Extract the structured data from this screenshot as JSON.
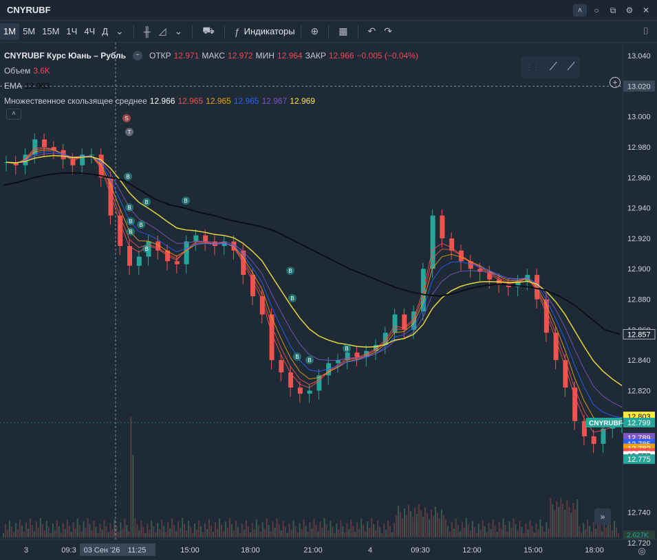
{
  "window": {
    "title": "CNYRUBF"
  },
  "toolbar": {
    "timeframes": [
      "1М",
      "5М",
      "15М",
      "1Ч",
      "4Ч",
      "Д"
    ],
    "active_timeframe": "1М",
    "indicators_label": "Индикаторы"
  },
  "legend": {
    "symbol": "CNYRUBF Курс Юань – Рубль",
    "open_label": "ОТКР",
    "open_value": "12.971",
    "high_label": "МАКС",
    "high_value": "12.972",
    "low_label": "МИН",
    "low_value": "12.964",
    "close_label": "ЗАКР",
    "close_value": "12.966",
    "change": "−0.005 (−0.04%)",
    "volume_label": "Объем",
    "volume_value": "3.6K",
    "ema_label": "EMA",
    "ema_value": "12.963",
    "mma_label": "Множественное скользящее среднее",
    "mma_values": [
      "12.966",
      "12.965",
      "12.965",
      "12.965",
      "12.967",
      "12.969"
    ]
  },
  "colors": {
    "background": "#1e2a36",
    "up": "#26a69a",
    "down": "#ef5350",
    "ema": "#000000",
    "mma": [
      "#ef5350",
      "#ef5350",
      "#f39c12",
      "#2962ff",
      "#7e57c2",
      "#ffeb3b"
    ]
  },
  "chart_data": {
    "type": "line",
    "subtype": "candlestick",
    "y_ticks": [
      "13.040",
      "13.020",
      "13.000",
      "12.980",
      "12.960",
      "12.940",
      "12.920",
      "12.900",
      "12.880",
      "12.860",
      "12.840",
      "12.820",
      "12.803",
      "12.799",
      "12.789",
      "12.785",
      "12.782",
      "12.779",
      "12.777",
      "12.775",
      "12.740",
      "12.720"
    ],
    "ylim": [
      12.72,
      13.045
    ],
    "x_ticks": [
      "3",
      "09:3",
      "03 Сен '26",
      "11:25",
      "15:00",
      "18:00",
      "21:00",
      "4",
      "09:30",
      "12:00",
      "15:00",
      "18:00"
    ],
    "crosshair": {
      "price": "13.020",
      "time": "03 Сен '26  11:25"
    },
    "price_labels": [
      {
        "text": "12.857",
        "color": "#1e2a36",
        "border": "#aab0ba"
      },
      {
        "text": "12.803",
        "color": "#ffeb3b"
      },
      {
        "text": "12.799",
        "color": "#26a69a",
        "tag": "CNYRUBF"
      },
      {
        "text": "12.789",
        "color": "#7e57c2"
      },
      {
        "text": "12.785",
        "color": "#2962ff"
      },
      {
        "text": "12.782",
        "color": "#f39c12"
      },
      {
        "text": "12.779",
        "color": "#ef5350"
      },
      {
        "text": "12.777",
        "color": "#ffffff"
      },
      {
        "text": "12.775",
        "color": "#26a69a"
      }
    ],
    "volume_label": "2.627K",
    "close_series": [
      12.97,
      12.968,
      12.975,
      12.985,
      12.98,
      12.978,
      12.972,
      12.968,
      12.975,
      12.975,
      12.96,
      12.935,
      12.915,
      12.902,
      12.908,
      12.918,
      12.912,
      12.905,
      12.903,
      12.918,
      12.922,
      12.918,
      12.915,
      12.918,
      12.912,
      12.896,
      12.882,
      12.87,
      12.84,
      12.832,
      12.822,
      12.818,
      12.82,
      12.83,
      12.838,
      12.84,
      12.845,
      12.842,
      12.846,
      12.85,
      12.858,
      12.87,
      12.86,
      12.872,
      12.9,
      12.935,
      12.92,
      12.912,
      12.905,
      12.9,
      12.898,
      12.893,
      12.89,
      12.888,
      12.892,
      12.896,
      12.88,
      12.858,
      12.84,
      12.822,
      12.8,
      12.79,
      12.785,
      12.795,
      12.798,
      12.799
    ],
    "ema_series": [
      12.955,
      12.957,
      12.96,
      12.962,
      12.963,
      12.963,
      12.962,
      12.96,
      12.958,
      12.952,
      12.946,
      12.942,
      12.94,
      12.937,
      12.935,
      12.932,
      12.93,
      12.928,
      12.925,
      12.92,
      12.915,
      12.91,
      12.905,
      12.9,
      12.896,
      12.892,
      12.888,
      12.885,
      12.883,
      12.882,
      12.884,
      12.887,
      12.889,
      12.89,
      12.889,
      12.888,
      12.886,
      12.882,
      12.876,
      12.868,
      12.86,
      12.857
    ],
    "markers": [
      "S",
      "T",
      "B"
    ]
  }
}
